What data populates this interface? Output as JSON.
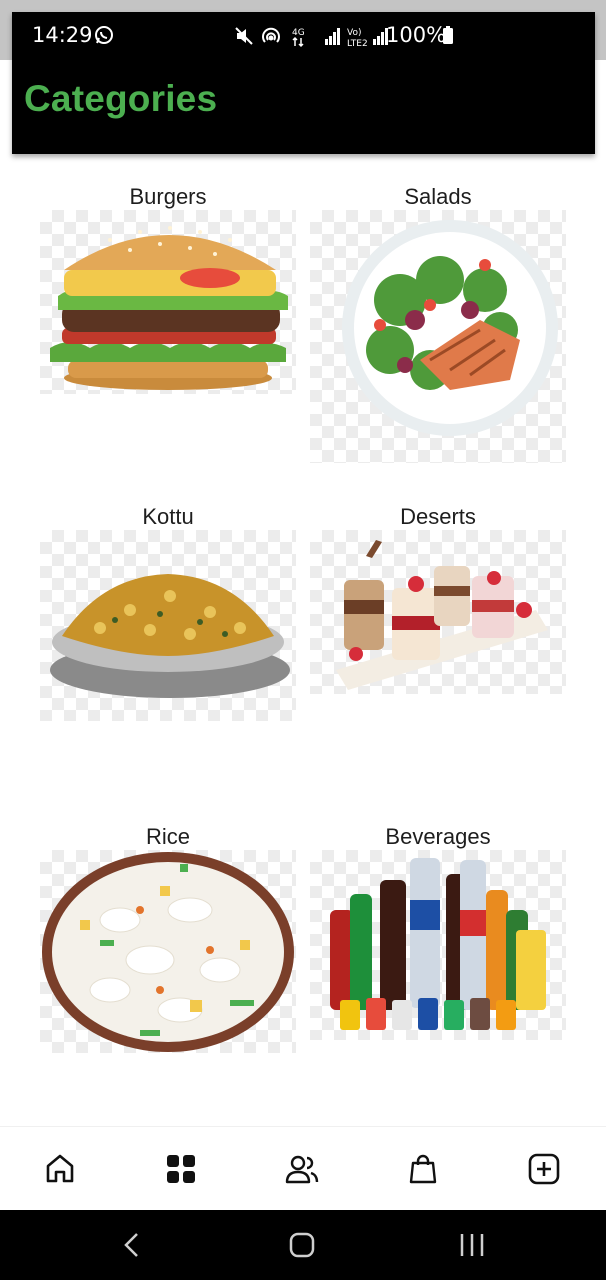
{
  "status_bar": {
    "time": "14:29",
    "battery": "100%",
    "network": "4G",
    "volte": "Vo) LTE2"
  },
  "app_bar": {
    "title": "Categories",
    "title_color": "#4caf50"
  },
  "categories": [
    {
      "label": "Burgers"
    },
    {
      "label": "Salads"
    },
    {
      "label": "Kottu"
    },
    {
      "label": "Deserts"
    },
    {
      "label": "Rice"
    },
    {
      "label": "Beverages"
    }
  ],
  "bottom_nav": [
    {
      "icon": "home-icon"
    },
    {
      "icon": "grid-icon",
      "active": true
    },
    {
      "icon": "users-icon"
    },
    {
      "icon": "shopping-bag-icon"
    },
    {
      "icon": "add-box-icon"
    }
  ],
  "system_nav": [
    "back-icon",
    "home-circle-icon",
    "recents-icon"
  ]
}
